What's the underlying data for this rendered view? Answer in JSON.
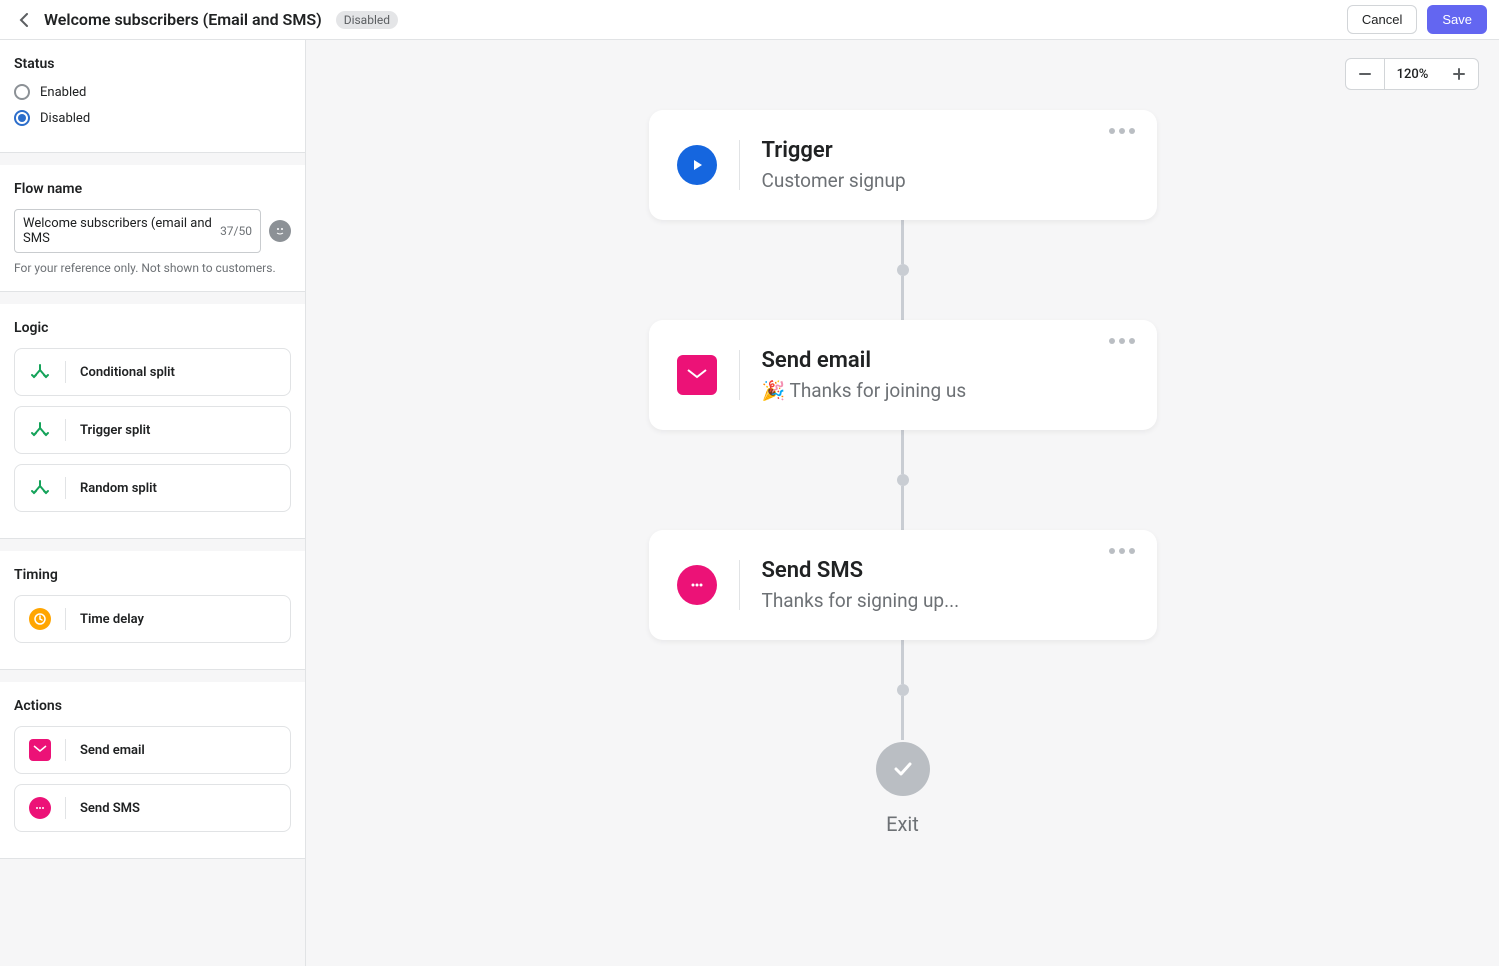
{
  "header": {
    "title": "Welcome subscribers (Email and SMS)",
    "status_pill": "Disabled",
    "cancel": "Cancel",
    "save": "Save"
  },
  "zoom": {
    "level": "120%"
  },
  "sidebar": {
    "status": {
      "title": "Status",
      "options": [
        {
          "label": "Enabled",
          "checked": false
        },
        {
          "label": "Disabled",
          "checked": true
        }
      ]
    },
    "flowname": {
      "title": "Flow name",
      "value": "Welcome subscribers (email and SMS",
      "counter": "37/50",
      "help": "For your reference only. Not shown to customers."
    },
    "logic": {
      "title": "Logic",
      "items": [
        "Conditional split",
        "Trigger split",
        "Random split"
      ]
    },
    "timing": {
      "title": "Timing",
      "items": [
        "Time delay"
      ]
    },
    "actions": {
      "title": "Actions",
      "items": [
        "Send email",
        "Send SMS"
      ]
    }
  },
  "nodes": {
    "trigger": {
      "title": "Trigger",
      "sub": "Customer signup"
    },
    "email": {
      "title": "Send email",
      "sub": "🎉 Thanks for joining us"
    },
    "sms": {
      "title": "Send SMS",
      "sub": "Thanks for signing up..."
    },
    "exit": "Exit"
  }
}
